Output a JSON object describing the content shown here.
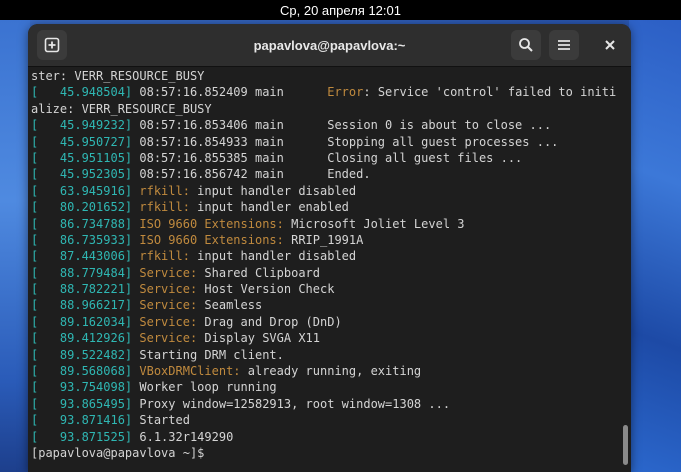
{
  "top_bar": {
    "clock": "Ср, 20 апреля  12:01"
  },
  "window": {
    "title": "papavlova@papavlova:~",
    "new_tab_icon": "new-tab-icon",
    "search_icon": "search-icon",
    "menu_icon": "hamburger-menu-icon",
    "close_icon": "close-icon"
  },
  "terminal": {
    "lines": [
      {
        "ts": "",
        "mod": "",
        "text": "ster: VERR_RESOURCE_BUSY"
      },
      {
        "ts": "[   45.948504]",
        "mod": " 08:57:16.852409 main      Error:",
        "text": " Service 'control' failed to initi"
      },
      {
        "ts": "",
        "mod": "",
        "text": "alize: VERR_RESOURCE_BUSY"
      },
      {
        "ts": "[   45.949232]",
        "mod": "",
        "text": " 08:57:16.853406 main      Session 0 is about to close ..."
      },
      {
        "ts": "[   45.950727]",
        "mod": "",
        "text": " 08:57:16.854933 main      Stopping all guest processes ..."
      },
      {
        "ts": "[   45.951105]",
        "mod": "",
        "text": " 08:57:16.855385 main      Closing all guest files ..."
      },
      {
        "ts": "[   45.952305]",
        "mod": "",
        "text": " 08:57:16.856742 main      Ended."
      },
      {
        "ts": "[   63.945916]",
        "mod": " rfkill:",
        "text": " input handler disabled"
      },
      {
        "ts": "[   80.201652]",
        "mod": " rfkill:",
        "text": " input handler enabled"
      },
      {
        "ts": "[   86.734788]",
        "mod": " ISO 9660 Extensions:",
        "text": " Microsoft Joliet Level 3"
      },
      {
        "ts": "[   86.735933]",
        "mod": " ISO 9660 Extensions:",
        "text": " RRIP_1991A"
      },
      {
        "ts": "[   87.443006]",
        "mod": " rfkill:",
        "text": " input handler disabled"
      },
      {
        "ts": "[   88.779484]",
        "mod": " Service:",
        "text": " Shared Clipboard"
      },
      {
        "ts": "[   88.782221]",
        "mod": " Service:",
        "text": " Host Version Check"
      },
      {
        "ts": "[   88.966217]",
        "mod": " Service:",
        "text": " Seamless"
      },
      {
        "ts": "[   89.162034]",
        "mod": " Service:",
        "text": " Drag and Drop (DnD)"
      },
      {
        "ts": "[   89.412926]",
        "mod": " Service:",
        "text": " Display SVGA X11"
      },
      {
        "ts": "[   89.522482]",
        "mod": "",
        "text": " Starting DRM client."
      },
      {
        "ts": "[   89.568068]",
        "mod": " VBoxDRMClient:",
        "text": " already running, exiting"
      },
      {
        "ts": "[   93.754098]",
        "mod": "",
        "text": " Worker loop running"
      },
      {
        "ts": "[   93.865495]",
        "mod": "",
        "text": " Proxy window=12582913, root window=1308 ..."
      },
      {
        "ts": "[   93.871416]",
        "mod": "",
        "text": " Started"
      },
      {
        "ts": "[   93.871525]",
        "mod": "",
        "text": " 6.1.32r149290"
      },
      {
        "ts": "",
        "mod": "",
        "text": "[papavlova@papavlova ~]$"
      }
    ]
  }
}
